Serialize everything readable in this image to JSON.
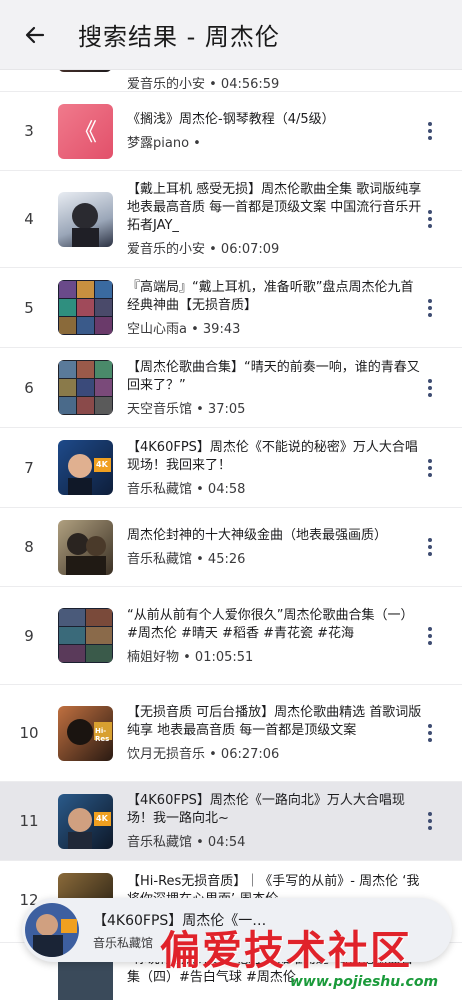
{
  "header": {
    "title": "搜索结果 - 周杰伦"
  },
  "partial_top": {
    "meta": "爱音乐的小安  •  04:56:59"
  },
  "items": [
    {
      "index": "3",
      "title": "《搁浅》周杰伦-钢琴教程（4/5级）",
      "meta": "梦露piano  •"
    },
    {
      "index": "4",
      "title": "【戴上耳机 感受无损】周杰伦歌曲全集 歌词版纯享 地表最高音质 每一首都是顶级文案 中国流行音乐开拓者JAY_",
      "meta": "爱音乐的小安  •  06:07:09"
    },
    {
      "index": "5",
      "title": "『高端局』“戴上耳机，准备听歌”盘点周杰伦九首经典神曲【无损音质】",
      "meta": "空山心雨a  •  39:43"
    },
    {
      "index": "6",
      "title": "【周杰伦歌曲合集】“晴天的前奏一响，谁的青春又回来了？”",
      "meta": "天空音乐馆  •  37:05"
    },
    {
      "index": "7",
      "title": "【4K60FPS】周杰伦《不能说的秘密》万人大合唱现场！我回来了！",
      "meta": "音乐私藏馆  •  04:58"
    },
    {
      "index": "8",
      "title": "周杰伦封神的十大神级金曲（地表最强画质）",
      "meta": "音乐私藏馆  •  45:26"
    },
    {
      "index": "9",
      "title": "“从前从前有个人爱你很久”周杰伦歌曲合集（一）#周杰伦 #晴天 #稻香 #青花瓷 #花海",
      "meta": "楠姐好物  •  01:05:51"
    },
    {
      "index": "10",
      "title": "【无损音质 可后台播放】周杰伦歌曲精选 首歌词版纯享 地表最高音质 每一首都是顶级文案",
      "meta": "饮月无损音乐  •  06:27:06"
    },
    {
      "index": "11",
      "title": "【4K60FPS】周杰伦《一路向北》万人大合唱现场！我一路向北~",
      "meta": "音乐私藏馆  •  04:54"
    },
    {
      "index": "12",
      "title": "【Hi-Res无损音质】｜《手写的从前》- 周杰伦 ‘我将你深埋在心里面’ 周杰伦",
      "meta": ""
    },
    {
      "index": "",
      "title": "“你说你有点难追，想让我知难而退”周杰伦歌曲合集（四）#告白气球 #周杰伦",
      "meta": ""
    }
  ],
  "now_playing": {
    "title": "【4K60FPS】周杰伦《一…",
    "artist": "音乐私藏馆"
  },
  "watermark": {
    "text": "偏爱技术社区",
    "url": "www.pojieshu.com"
  },
  "thumb_labels": {
    "hires": "Hi-Res",
    "k4": "4K"
  },
  "colors": {
    "header_bg": "#f2f2f4",
    "highlight_row": "#e6e6ea",
    "more_dots": "#3f4d72",
    "watermark": "#e0222a"
  }
}
